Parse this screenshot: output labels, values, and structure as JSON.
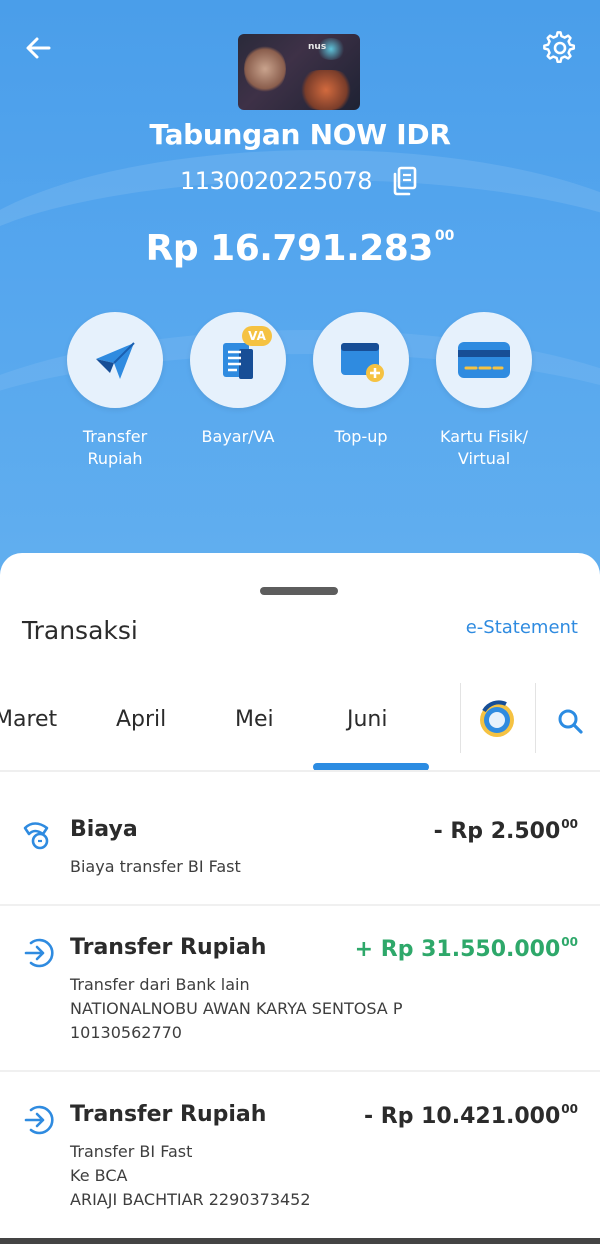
{
  "header": {
    "account_name": "Tabungan NOW IDR",
    "account_number": "1130020225078",
    "balance_main": "Rp 16.791.283",
    "balance_cents": "00",
    "card_brand": "nus",
    "actions": [
      {
        "label_line1": "Transfer",
        "label_line2": "Rupiah",
        "icon": "paper-plane-icon"
      },
      {
        "label_line1": "Bayar/VA",
        "label_line2": "",
        "icon": "bill-va-icon",
        "badge": "VA"
      },
      {
        "label_line1": "Top-up",
        "label_line2": "",
        "icon": "wallet-plus-icon"
      },
      {
        "label_line1": "Kartu Fisik/",
        "label_line2": "Virtual",
        "icon": "card-icon"
      }
    ]
  },
  "sheet": {
    "title": "Transaksi",
    "estatement": "e-Statement",
    "months": [
      "Maret",
      "April",
      "Mei",
      "Juni"
    ],
    "selected_month": "Juni"
  },
  "transactions": [
    {
      "title": "Biaya",
      "amount": "- Rp 2.500",
      "cents": "00",
      "direction": "debit",
      "lines": [
        "Biaya transfer BI Fast"
      ]
    },
    {
      "title": "Transfer Rupiah",
      "amount": "+ Rp 31.550.000",
      "cents": "00",
      "direction": "credit",
      "lines": [
        "Transfer dari Bank lain",
        "NATIONALNOBU AWAN KARYA SENTOSA P",
        "10130562770"
      ]
    },
    {
      "title": "Transfer Rupiah",
      "amount": "- Rp 10.421.000",
      "cents": "00",
      "direction": "debit",
      "lines": [
        "Transfer BI Fast",
        "Ke BCA",
        "ARIAJI BACHTIAR 2290373452"
      ]
    }
  ],
  "colors": {
    "header_blue": "#4a9eea",
    "accent_blue": "#2c8ce2",
    "credit_green": "#2ea86a"
  }
}
